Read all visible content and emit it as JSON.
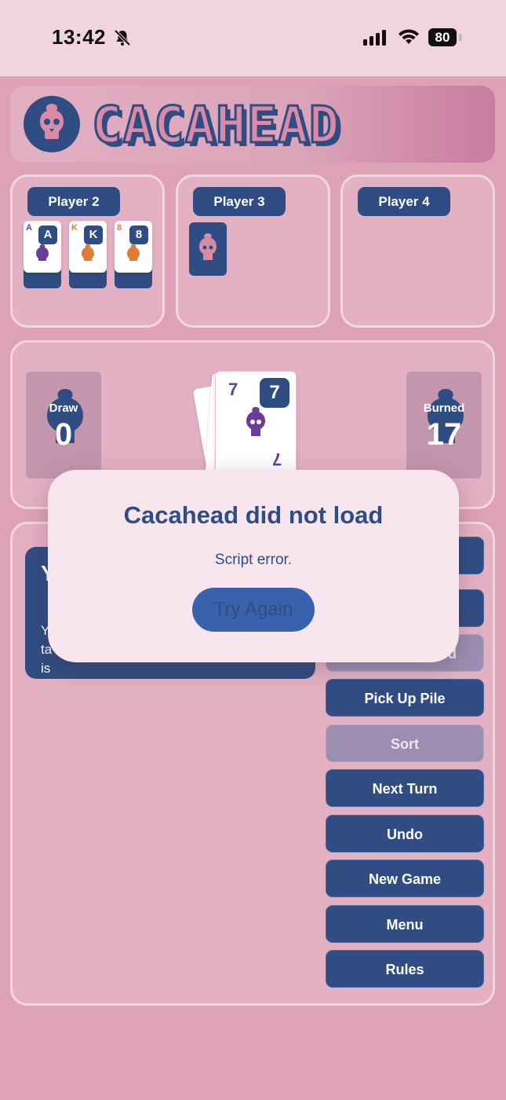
{
  "status_bar": {
    "time": "13:42",
    "battery": "80"
  },
  "app": {
    "title": "CACAHEAD"
  },
  "players": [
    {
      "name": "Player 2",
      "cards": [
        {
          "rank": "A",
          "color": "#6b3d9a"
        },
        {
          "rank": "K",
          "color": "#e07b39"
        },
        {
          "rank": "8",
          "color": "#e07b39"
        }
      ]
    },
    {
      "name": "Player 3"
    },
    {
      "name": "Player 4"
    }
  ],
  "table": {
    "draw_label": "Draw",
    "draw_count": "0",
    "burned_label": "Burned",
    "burned_count": "17",
    "top_card": {
      "rank": "7",
      "color": "#6b3d9a"
    }
  },
  "info_box": {
    "heading": "Y",
    "text_line1": "Y",
    "text_line2": "ta",
    "text_line3": "is"
  },
  "buttons": [
    {
      "label": "",
      "disabled": false
    },
    {
      "label": "",
      "disabled": false
    },
    {
      "label": "d",
      "disabled": true
    },
    {
      "label": "Pick Up Pile",
      "disabled": false
    },
    {
      "label": "Sort",
      "disabled": true
    },
    {
      "label": "Next Turn",
      "disabled": false
    },
    {
      "label": "Undo",
      "disabled": false
    },
    {
      "label": "New Game",
      "disabled": false
    },
    {
      "label": "Menu",
      "disabled": false
    },
    {
      "label": "Rules",
      "disabled": false
    }
  ],
  "error_dialog": {
    "title": "Cacahead did not load",
    "message": "Script error.",
    "retry_label": "Try Again"
  },
  "colors": {
    "primary": "#2f4d82",
    "background": "#dda2b7",
    "accent": "#d98aa7"
  }
}
